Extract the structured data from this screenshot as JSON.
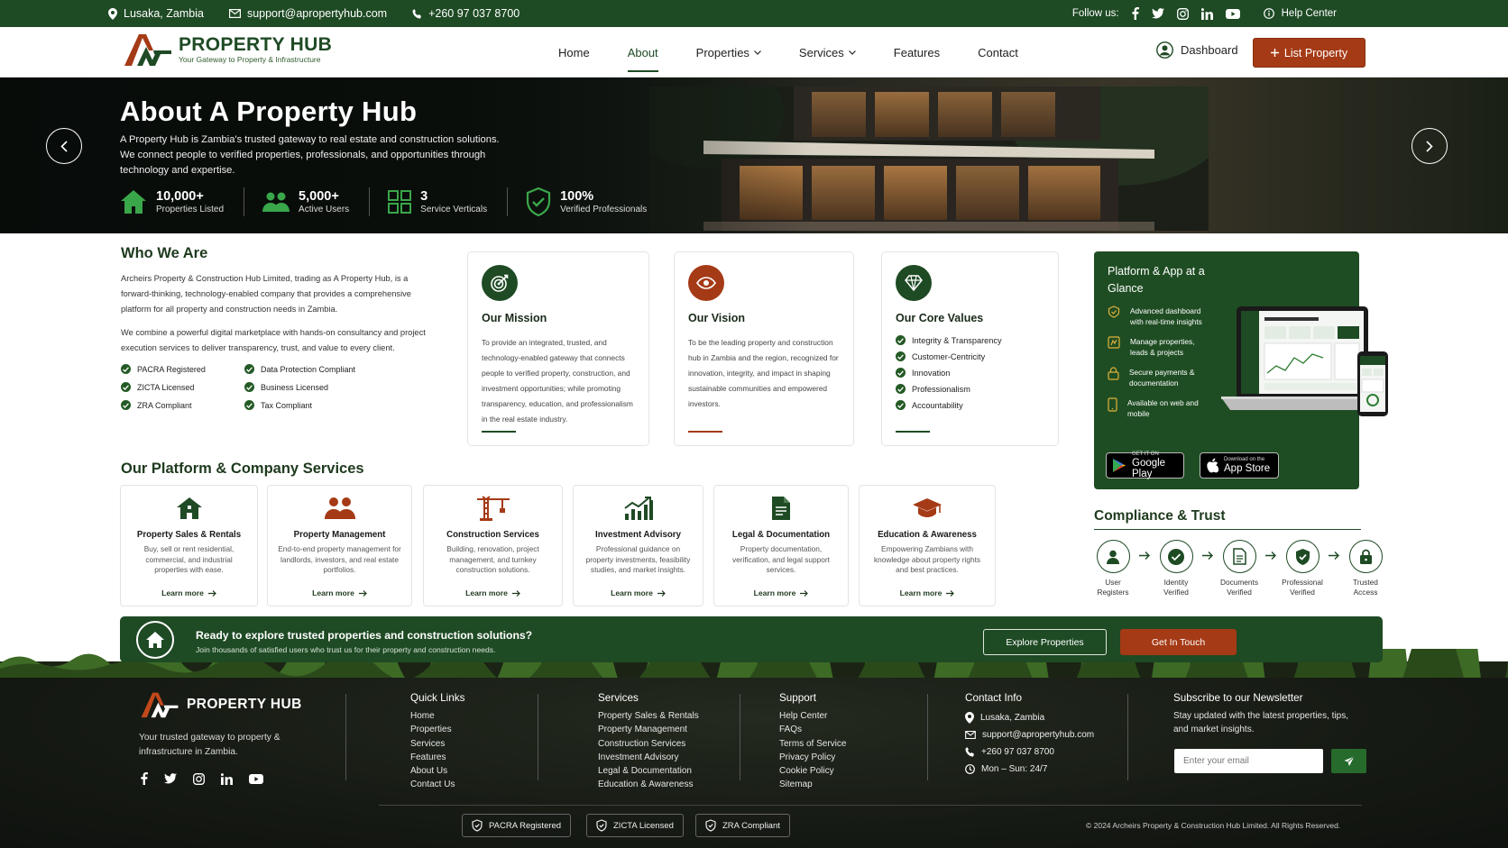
{
  "topbar": {
    "location": "Lusaka, Zambia",
    "email": "support@apropertyhub.com",
    "phone": "+260 97 037 8700",
    "follow_label": "Follow us:",
    "help_label": "Help Center",
    "social_icons": [
      "facebook-icon",
      "twitter-icon",
      "instagram-icon",
      "linkedin-icon",
      "youtube-icon"
    ]
  },
  "brand": {
    "name": "PROPERTY HUB",
    "tagline": "Your Gateway to Property & Infrastructure",
    "green": "#1e4a24",
    "accent": "#a53a16"
  },
  "nav": {
    "items": [
      {
        "label": "Home"
      },
      {
        "label": "About",
        "active": true
      },
      {
        "label": "Properties",
        "dropdown": true
      },
      {
        "label": "Services",
        "dropdown": true
      },
      {
        "label": "Features"
      },
      {
        "label": "Contact"
      }
    ],
    "dashboard": "Dashboard",
    "list_property": "List Property"
  },
  "hero": {
    "title": "About A Property Hub",
    "description": "A Property Hub is Zambia's trusted gateway to real estate and construction solutions. We connect people to verified properties, professionals, and opportunities through technology and expertise.",
    "stats": [
      {
        "value": "10,000+",
        "label": "Properties Listed",
        "icon": "house-icon"
      },
      {
        "value": "5,000+",
        "label": "Active Users",
        "icon": "users-icon"
      },
      {
        "value": "3",
        "label": "Service Verticals",
        "icon": "grid-icon"
      },
      {
        "value": "100%",
        "label": "Verified Professionals",
        "icon": "shield-check-icon"
      }
    ]
  },
  "who": {
    "title": "Who We Are",
    "p1": "Archeirs Property & Construction Hub Limited, trading as A Property Hub, is a forward-thinking, technology-enabled company that provides a comprehensive platform for all property and construction needs in Zambia.",
    "p2": "We combine a powerful digital marketplace with hands-on consultancy and project execution services to deliver transparency, trust, and value to every client.",
    "checks": [
      "PACRA Registered",
      "Data Protection Compliant",
      "ZICTA Licensed",
      "Business Licensed",
      "ZRA Compliant",
      "Tax Compliant"
    ]
  },
  "mission": {
    "title": "Our Mission",
    "text": "To provide an integrated, trusted, and technology-enabled gateway that connects people to verified property, construction, and investment opportunities; while promoting transparency, education, and professionalism in the real estate industry."
  },
  "vision": {
    "title": "Our Vision",
    "text": "To be the leading property and construction hub in Zambia and the region, recognized for innovation, integrity, and impact in shaping sustainable communities and empowered investors."
  },
  "values": {
    "title": "Our Core Values",
    "items": [
      "Integrity & Transparency",
      "Customer-Centricity",
      "Innovation",
      "Professionalism",
      "Accountability"
    ]
  },
  "platform": {
    "title": "Platform & App at a Glance",
    "items": [
      {
        "text": "Advanced dashboard with real-time insights",
        "icon": "dashboard-icon"
      },
      {
        "text": "Manage properties, leads & projects",
        "icon": "manage-icon"
      },
      {
        "text": "Secure payments & documentation",
        "icon": "lock-icon"
      },
      {
        "text": "Available on web and mobile",
        "icon": "mobile-icon"
      }
    ],
    "google_small": "GET IT ON",
    "google_big": "Google Play",
    "apple_small": "Download on the",
    "apple_big": "App Store"
  },
  "services": {
    "title": "Our Platform & Company Services",
    "learn_more": "Learn more",
    "items": [
      {
        "title": "Property Sales & Rentals",
        "text": "Buy, sell or rent residential, commercial, and industrial properties with ease.",
        "icon": "house-icon"
      },
      {
        "title": "Property Management",
        "text": "End-to-end property management for landlords, investors, and real estate portfolios.",
        "icon": "people-icon"
      },
      {
        "title": "Construction Services",
        "text": "Building, renovation, project management, and turnkey construction solutions.",
        "icon": "crane-icon"
      },
      {
        "title": "Investment Advisory",
        "text": "Professional guidance on property investments, feasibility studies, and market insights.",
        "icon": "growth-chart-icon"
      },
      {
        "title": "Legal & Documentation",
        "text": "Property documentation, verification, and legal support services.",
        "icon": "document-icon"
      },
      {
        "title": "Education & Awareness",
        "text": "Empowering Zambians with knowledge about property rights and best practices.",
        "icon": "graduation-cap-icon"
      }
    ]
  },
  "compliance": {
    "title": "Compliance & Trust",
    "steps": [
      {
        "label": "User Registers",
        "icon": "user-icon"
      },
      {
        "label": "Identity Verified",
        "icon": "check-circle-icon"
      },
      {
        "label": "Documents Verified",
        "icon": "document-icon"
      },
      {
        "label": "Professional Verified",
        "icon": "shield-check-icon"
      },
      {
        "label": "Trusted Access",
        "icon": "lock-icon"
      }
    ]
  },
  "cta": {
    "title": "Ready to explore trusted properties and construction solutions?",
    "subtitle": "Join thousands of satisfied users who trust us for their property and construction needs.",
    "explore": "Explore Properties",
    "touch": "Get In Touch"
  },
  "footer": {
    "brand": "PROPERTY HUB",
    "tagline": "Your trusted gateway to property & infrastructure in Zambia.",
    "quick_title": "Quick Links",
    "quick_links": [
      "Home",
      "Properties",
      "Services",
      "Features",
      "About Us",
      "Contact Us"
    ],
    "services_title": "Services",
    "services_links": [
      "Property Sales & Rentals",
      "Property Management",
      "Construction Services",
      "Investment Advisory",
      "Legal & Documentation",
      "Education & Awareness"
    ],
    "support_title": "Support",
    "support_links": [
      "Help Center",
      "FAQs",
      "Terms of Service",
      "Privacy Policy",
      "Cookie Policy",
      "Sitemap"
    ],
    "contact_title": "Contact Info",
    "contact": {
      "location": "Lusaka, Zambia",
      "email": "support@apropertyhub.com",
      "phone": "+260 97 037 8700",
      "hours": "Mon – Sun: 24/7"
    },
    "newsletter_title": "Subscribe to our Newsletter",
    "newsletter_text": "Stay updated with the latest properties, tips, and market insights.",
    "email_placeholder": "Enter your email",
    "badges": [
      "PACRA Registered",
      "ZICTA Licensed",
      "ZRA Compliant"
    ],
    "copyright": "© 2024 Archeirs Property & Construction Hub Limited. All Rights Reserved."
  }
}
